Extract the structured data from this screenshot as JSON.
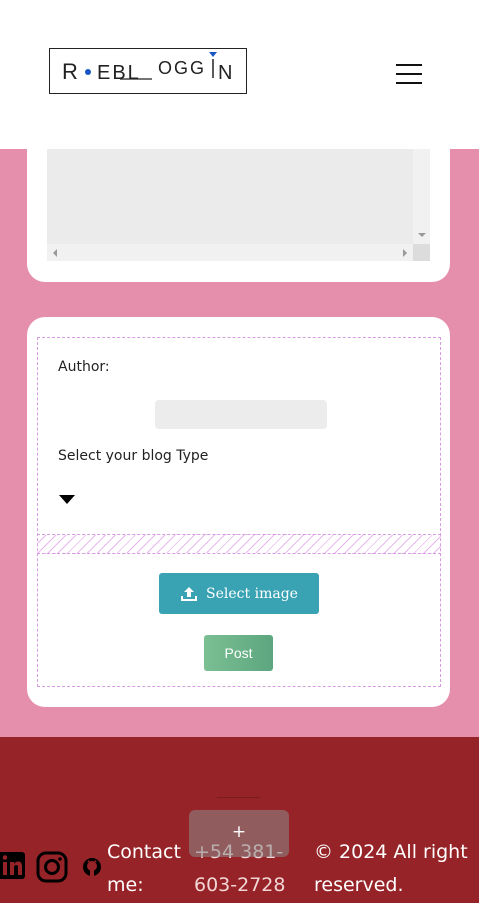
{
  "header": {
    "logo_text": "R EBL OGGIN",
    "logo_parts": [
      "R",
      "EBL",
      "OGG",
      "N"
    ],
    "menu_icon": "hamburger-icon"
  },
  "form": {
    "author_label": "Author:",
    "author_value": "",
    "blog_type_label": "Select your blog Type",
    "blog_type_value": "",
    "select_image_label": "Select image",
    "post_label": "Post"
  },
  "footer": {
    "contact_label": "Contact me:",
    "phone": "+54 381-603-2728",
    "copyright": "© 2024 All right reserved.",
    "fab_label": "+",
    "social_icons": [
      "linkedin-icon",
      "instagram-icon",
      "github-icon"
    ]
  },
  "colors": {
    "page_bg": "#e68fac",
    "footer_bg": "#962327",
    "select_image_btn": "#3aa3b3",
    "post_btn": "#6cb489",
    "logo_dot": "#1a56c4"
  }
}
